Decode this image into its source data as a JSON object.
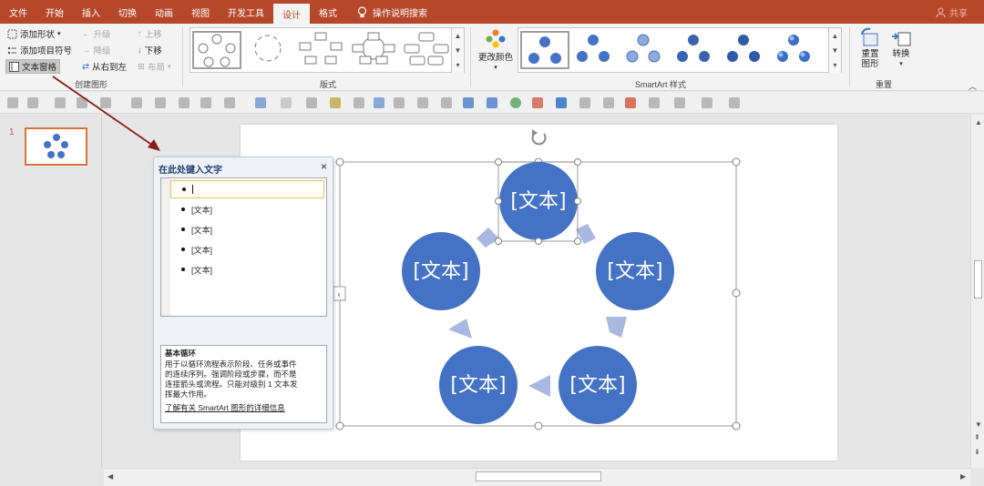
{
  "tabs": [
    "文件",
    "开始",
    "插入",
    "切换",
    "动画",
    "视图",
    "开发工具",
    "设计",
    "格式"
  ],
  "active_tab": "设计",
  "tell_me": "操作说明搜索",
  "share": "共享",
  "ribbon": {
    "create_graphic": {
      "label": "创建图形",
      "add_shape": "添加形状",
      "add_bullet": "添加项目符号",
      "text_pane": "文本窗格",
      "promote": "升级",
      "demote": "降级",
      "rtl": "从右到左",
      "move_up": "上移",
      "move_down": "下移",
      "layout": "布局"
    },
    "layouts": {
      "label": "版式"
    },
    "styles": {
      "label": "SmartArt 样式",
      "change_colors": "更改颜色"
    },
    "reset": {
      "label": "重置",
      "reset_graphic": "重置图形",
      "convert": "转换"
    }
  },
  "slide_number": "1",
  "text_pane": {
    "title": "在此处键入文字",
    "items": [
      "",
      "[文本]",
      "[文本]",
      "[文本]",
      "[文本]"
    ],
    "desc_title": "基本循环",
    "desc_lines": [
      "用于以循环流程表示阶段、任务或事件",
      "的连续序列。强调阶段或步骤，而不是",
      "连接箭头或流程。只能对级别 1 文本发",
      "挥最大作用。"
    ],
    "learn_more": "了解有关 SmartArt 图形的详细信息"
  },
  "diagram": {
    "node_text": [
      "[文本]",
      "[文本]",
      "[文本]",
      "[文本]",
      "[文本]"
    ]
  },
  "colors": {
    "title_bar": "#b7472a",
    "node_fill": "#4472c4",
    "arrow_fill": "#a9b8de",
    "annotation_arrow": "#8b1a1a"
  },
  "icons": [
    "rotate-handle-icon",
    "collapse-pane-icon",
    "close-icon",
    "lightbulb-icon",
    "user-icon"
  ]
}
